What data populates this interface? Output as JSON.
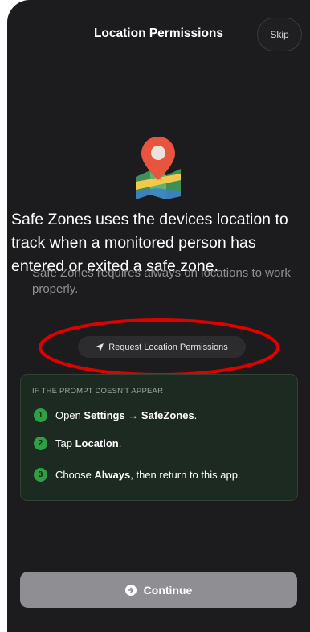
{
  "header": {
    "title": "Location Permissions",
    "skip_label": "Skip"
  },
  "hero": {
    "icon": "map-pin-icon",
    "headline": "Safe Zones uses the devices location to track when a monitored person has entered or exited a safe zone.",
    "subtext": "Safe Zones requires always on locations to work properly."
  },
  "request_button": {
    "icon": "location-arrow-icon",
    "label": "Request Location Permissions"
  },
  "help_card": {
    "heading": "IF THE PROMPT DOESN'T APPEAR",
    "steps": [
      {
        "number": "1",
        "text_before": "Open ",
        "bold": "Settings → SafeZones",
        "text_after": "."
      },
      {
        "number": "2",
        "text_before": "Tap ",
        "bold": "Location",
        "text_after": "."
      },
      {
        "number": "3",
        "text_before": "Choose ",
        "bold": "Always",
        "text_after": ", then return to this app."
      }
    ]
  },
  "footer": {
    "continue_label": "Continue",
    "continue_icon": "arrow-right-circle-icon"
  },
  "colors": {
    "background": "#1c1c1e",
    "card_background": "#1d2a21",
    "step_badge": "#2ea043",
    "highlight_annotation": "#e00000",
    "continue_button": "#8e8e93"
  }
}
